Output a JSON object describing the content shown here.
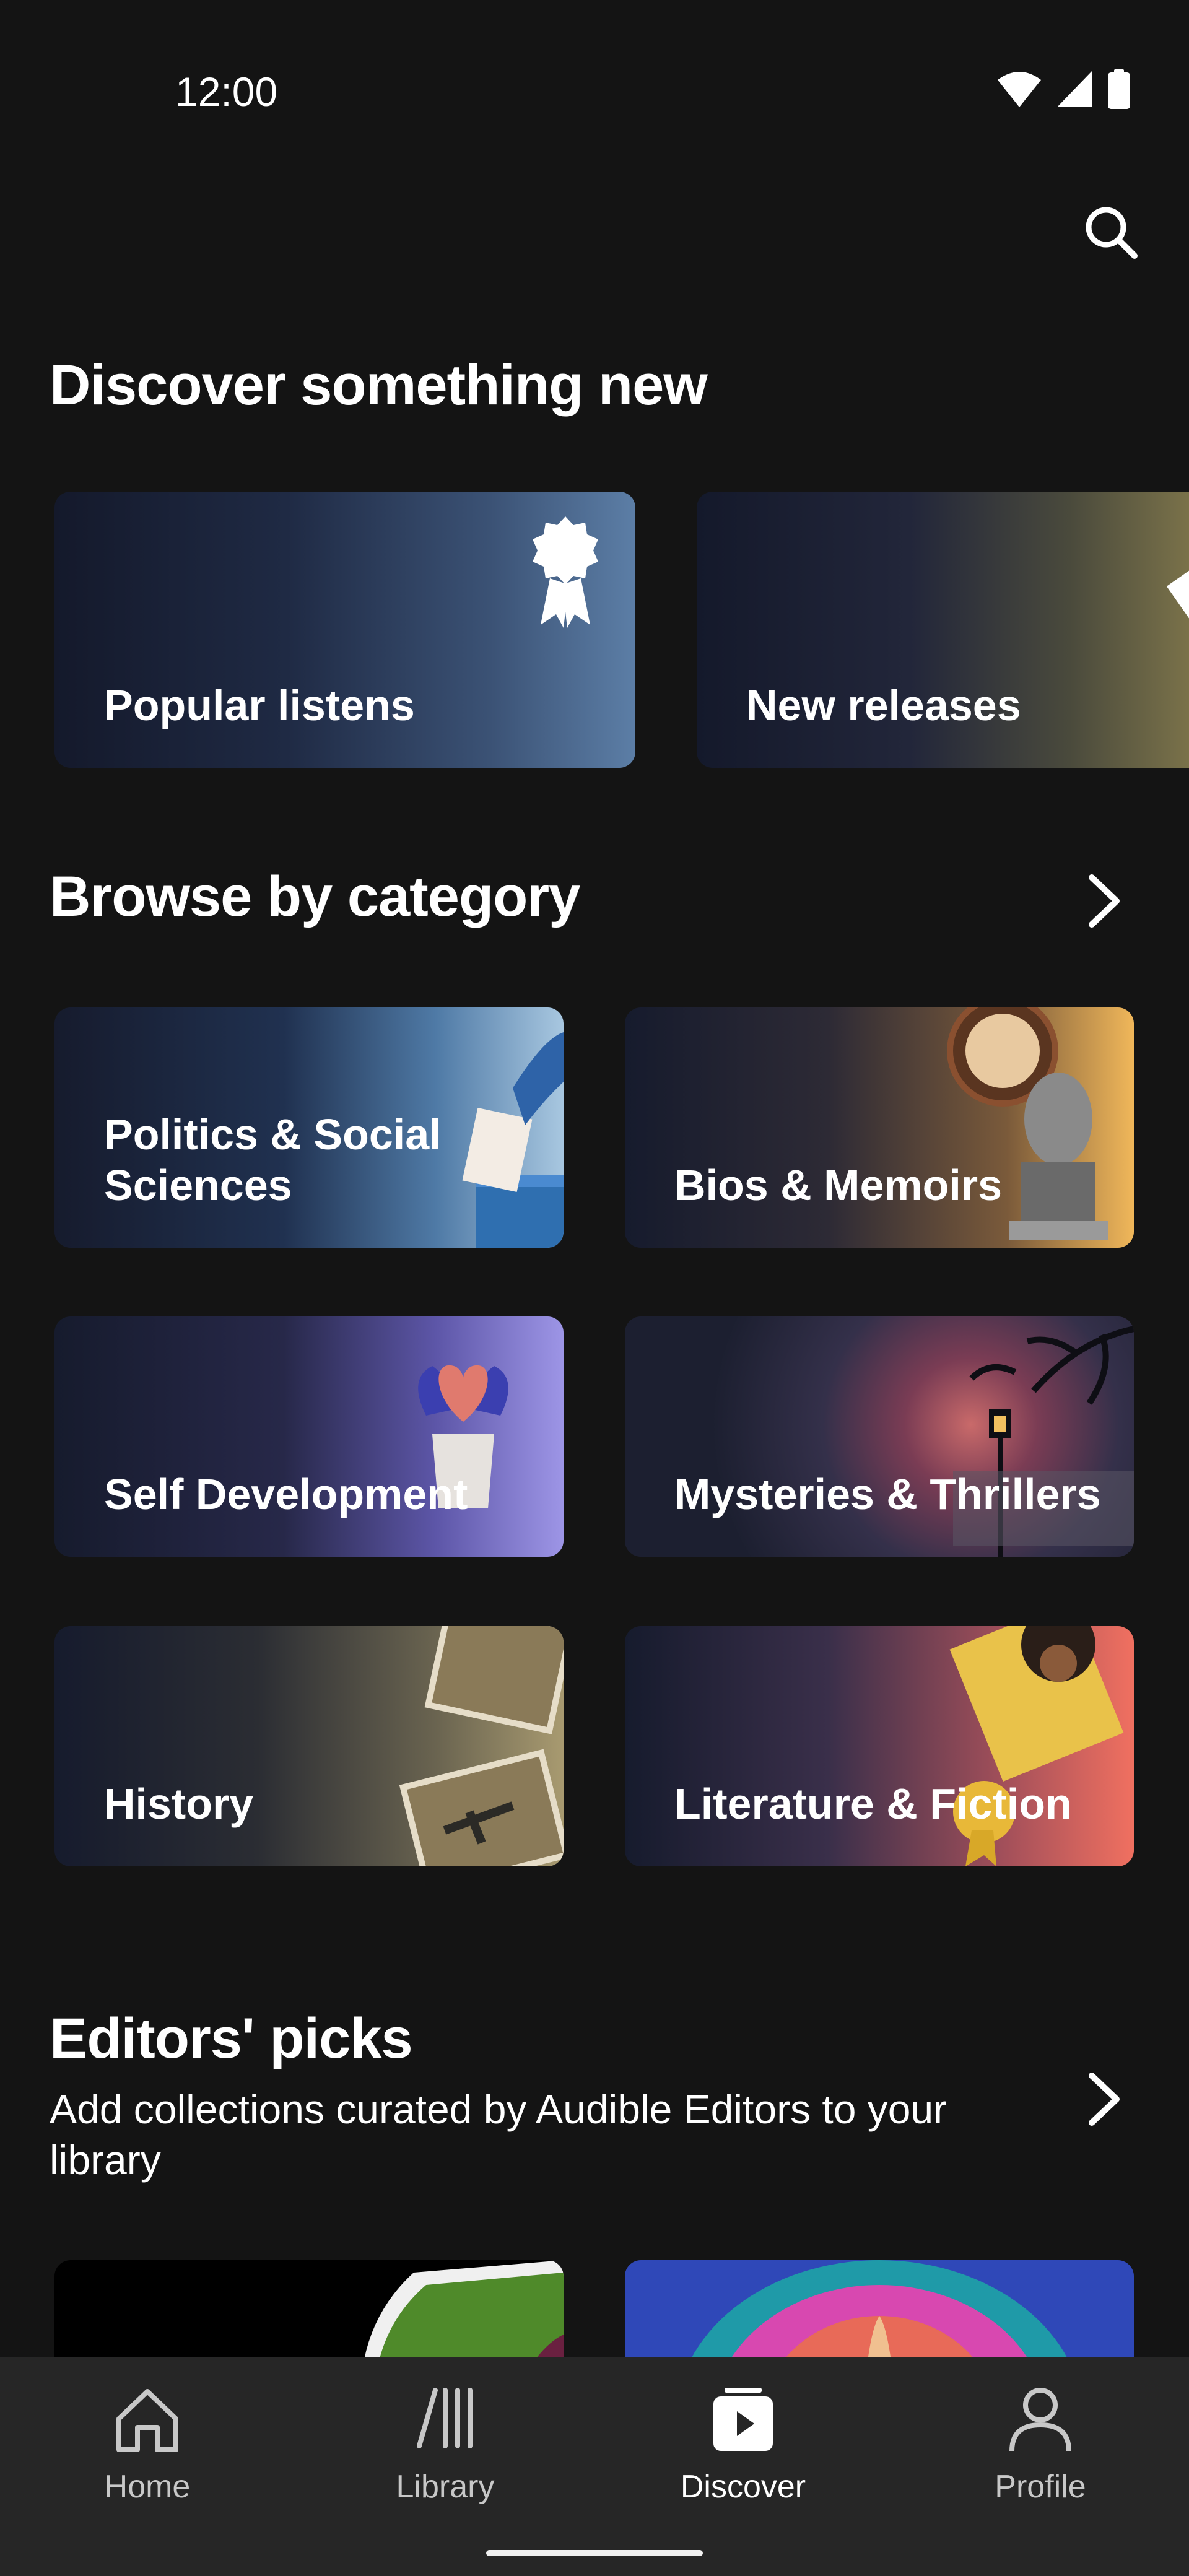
{
  "status_bar": {
    "time": "12:00"
  },
  "sections": {
    "discover": {
      "title": "Discover something new"
    },
    "browse": {
      "title": "Browse by category"
    },
    "editors": {
      "title": "Editors' picks",
      "subtitle_line1": "Add collections curated by Audible Editors to your",
      "subtitle_line2": "library"
    }
  },
  "discover_cards": [
    {
      "label": "Popular listens",
      "icon": "award-ribbon-icon"
    },
    {
      "label": "New releases",
      "icon": "tag-icon"
    }
  ],
  "categories": [
    {
      "line1": "Politics & Social",
      "line2": "Sciences"
    },
    {
      "line1": "Bios & Memoirs"
    },
    {
      "line1": "Self Development"
    },
    {
      "line1": "Mysteries & Thrillers"
    },
    {
      "line1": "History"
    },
    {
      "line1": "Literature & Fiction"
    }
  ],
  "nav": {
    "items": [
      {
        "label": "Home",
        "icon": "home-icon"
      },
      {
        "label": "Library",
        "icon": "library-icon"
      },
      {
        "label": "Discover",
        "icon": "discover-play-icon",
        "active": true
      },
      {
        "label": "Profile",
        "icon": "profile-icon"
      }
    ]
  },
  "colors": {
    "background": "#141414",
    "nav_background": "#262626",
    "text": "#ffffff",
    "inactive_nav_text": "#c8c8c8"
  }
}
